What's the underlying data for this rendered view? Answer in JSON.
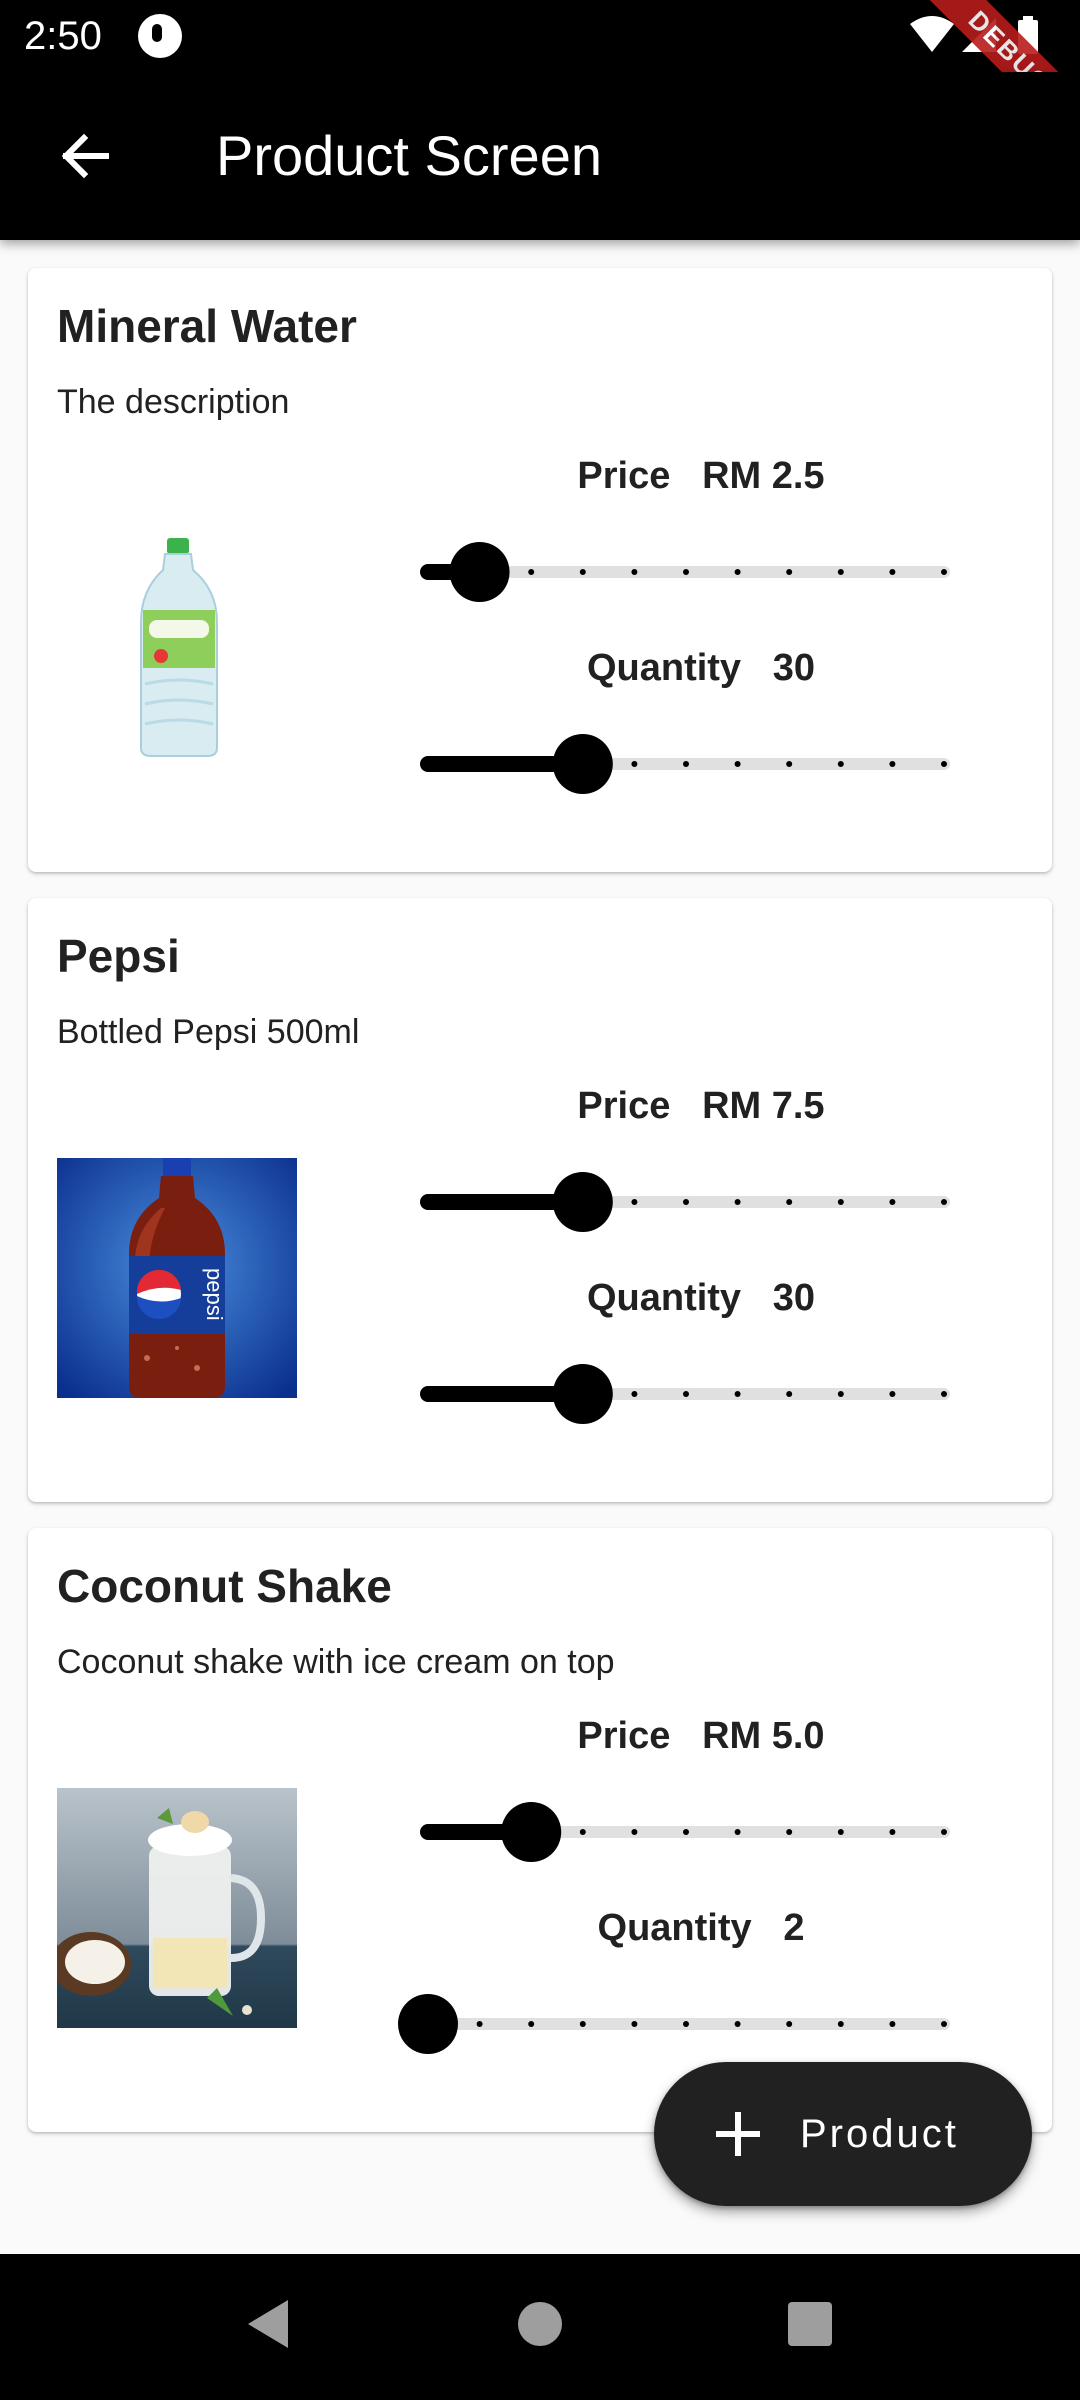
{
  "status_bar": {
    "time": "2:50",
    "debug_label": "DEBUG"
  },
  "app_bar": {
    "title": "Product Screen"
  },
  "products": [
    {
      "name": "Mineral Water",
      "description": "The description",
      "image": "mineral-water-bottle",
      "price_label": "Price",
      "price_value": "RM 2.5",
      "price_fraction": 0.1,
      "quantity_label": "Quantity",
      "quantity_value": "30",
      "quantity_fraction": 0.3
    },
    {
      "name": "Pepsi",
      "description": "Bottled Pepsi 500ml",
      "image": "pepsi-bottle",
      "price_label": "Price",
      "price_value": "RM 7.5",
      "price_fraction": 0.3,
      "quantity_label": "Quantity",
      "quantity_value": "30",
      "quantity_fraction": 0.3
    },
    {
      "name": "Coconut Shake",
      "description": "Coconut shake with ice cream on top",
      "image": "coconut-shake",
      "price_label": "Price",
      "price_value": "RM 5.0",
      "price_fraction": 0.2,
      "quantity_label": "Quantity",
      "quantity_value": "2",
      "quantity_fraction": 0.0
    }
  ],
  "fab": {
    "label": "Product",
    "icon": "plus-icon"
  },
  "colors": {
    "app_bar": "#000000",
    "slider_active": "#000000",
    "slider_inactive": "#e0e0e0",
    "fab": "#212121",
    "debug_ribbon": "#b71c1c"
  }
}
